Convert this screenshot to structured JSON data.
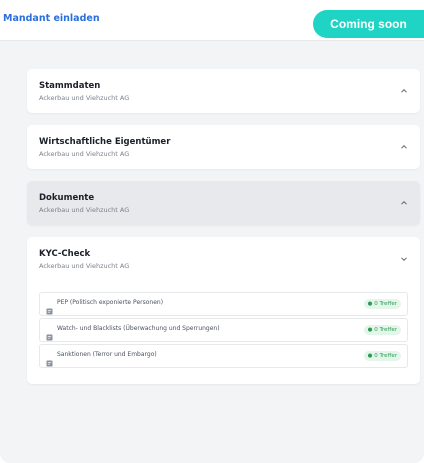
{
  "header": {
    "invite_label": "Mandant einladen",
    "coming_soon_label": "Coming soon"
  },
  "sections": [
    {
      "title": "Stammdaten",
      "subtitle": "Ackerbau und Viehzucht AG"
    },
    {
      "title": "Wirtschaftliche Eigentümer",
      "subtitle": "Ackerbau und Viehzucht AG"
    },
    {
      "title": "Dokumente",
      "subtitle": "Ackerbau und Viehzucht AG"
    },
    {
      "title": "KYC-Check",
      "subtitle": "Ackerbau und Viehzucht AG"
    }
  ],
  "kyc_checks": [
    {
      "label": "PEP (Politisch exponierte Personen)",
      "badge": "0 Treffer"
    },
    {
      "label": "Watch- und Blacklists (Überwachung und Sperrungen)",
      "badge": "0 Treffer"
    },
    {
      "label": "Sanktionen (Terror und Embargo)",
      "badge": "0 Treffer"
    }
  ],
  "colors": {
    "accent": "#1fd4c4",
    "link": "#2a6fdb",
    "success": "#2f9a55"
  }
}
